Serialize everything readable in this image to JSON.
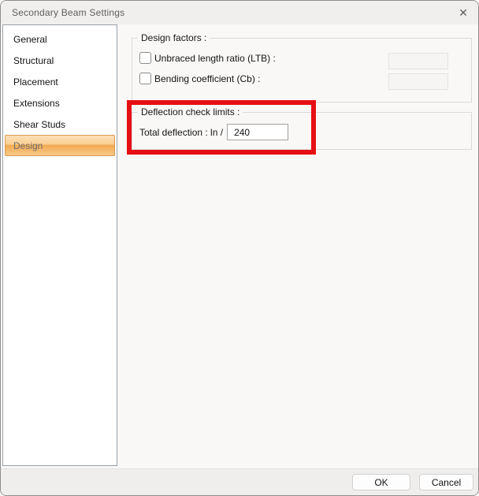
{
  "window": {
    "title": "Secondary Beam Settings",
    "close_icon": "✕"
  },
  "sidebar": {
    "items": [
      {
        "label": "General",
        "selected": false
      },
      {
        "label": "Structural",
        "selected": false
      },
      {
        "label": "Placement",
        "selected": false
      },
      {
        "label": "Extensions",
        "selected": false
      },
      {
        "label": "Shear Studs",
        "selected": false
      },
      {
        "label": "Design",
        "selected": true
      }
    ]
  },
  "main": {
    "design_factors": {
      "title": "Design factors :",
      "rows": [
        {
          "label": "Unbraced length ratio (LTB) :",
          "checked": false,
          "value": "",
          "enabled": false
        },
        {
          "label": "Bending coefficient (Cb) :",
          "checked": false,
          "value": "",
          "enabled": false
        }
      ]
    },
    "deflection_limits": {
      "title": "Deflection check limits :",
      "label": "Total deflection : ln /",
      "value": "240"
    }
  },
  "annotation": {
    "type": "highlight-rectangle",
    "color": "#e60f15"
  },
  "footer": {
    "ok_label": "OK",
    "cancel_label": "Cancel"
  },
  "colors": {
    "titlebar_bg": "#f1efee",
    "panel_bg": "#f9f8f7",
    "selected_item_border": "#d79a4e",
    "selected_item_gradient_top": "#fcdfb7",
    "selected_item_gradient_bottom": "#f7c887",
    "group_border": "#dcdad9"
  }
}
